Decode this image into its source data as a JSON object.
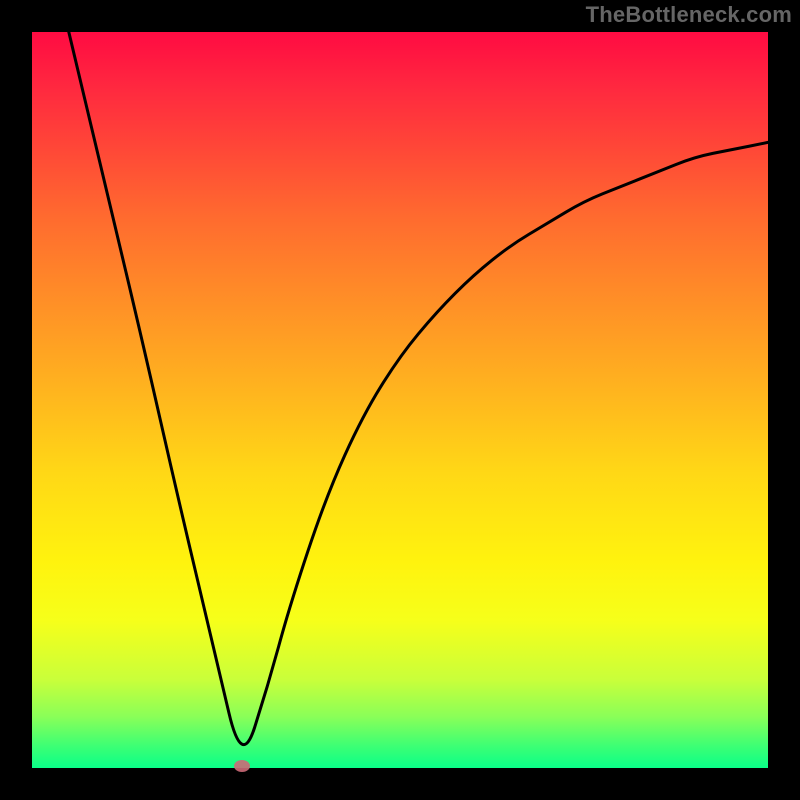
{
  "watermark": "TheBottleneck.com",
  "chart_data": {
    "type": "line",
    "title": "",
    "xlabel": "",
    "ylabel": "",
    "xlim": [
      0,
      100
    ],
    "ylim": [
      0,
      100
    ],
    "grid": false,
    "legend": false,
    "colors": {
      "curve": "#000000",
      "background_gradient": [
        "#ff0b42",
        "#ffb21f",
        "#fff30e",
        "#0aff88"
      ],
      "marker": "#cc6a78",
      "frame": "#000000"
    },
    "marker": {
      "x": 28.5,
      "y": 0
    },
    "series": [
      {
        "name": "bottleneck-curve",
        "x": [
          5,
          10,
          15,
          20,
          25,
          28.5,
          32,
          35,
          40,
          45,
          50,
          55,
          60,
          65,
          70,
          75,
          80,
          85,
          90,
          95,
          100
        ],
        "values": [
          100,
          79,
          58,
          36,
          15,
          0,
          11,
          22,
          37,
          48,
          56,
          62,
          67,
          71,
          74,
          77,
          79,
          81,
          83,
          84,
          85
        ]
      }
    ]
  }
}
